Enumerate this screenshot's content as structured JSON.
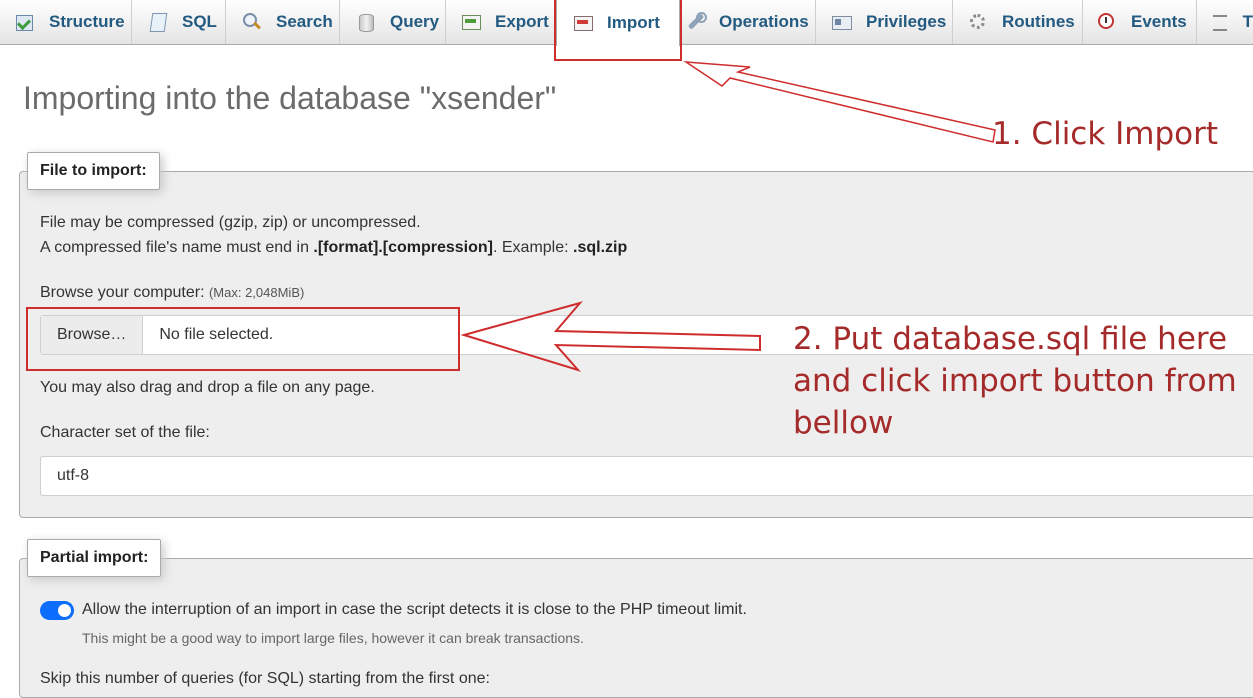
{
  "tabs": [
    {
      "label": "Structure",
      "icon": "structure-icon"
    },
    {
      "label": "SQL",
      "icon": "sql-icon"
    },
    {
      "label": "Search",
      "icon": "search-icon"
    },
    {
      "label": "Query",
      "icon": "query-icon"
    },
    {
      "label": "Export",
      "icon": "export-icon"
    },
    {
      "label": "Import",
      "icon": "import-icon",
      "active": true
    },
    {
      "label": "Operations",
      "icon": "operations-icon"
    },
    {
      "label": "Privileges",
      "icon": "privileges-icon"
    },
    {
      "label": "Routines",
      "icon": "routines-icon"
    },
    {
      "label": "Events",
      "icon": "events-icon"
    },
    {
      "label": "T",
      "icon": "triggers-icon"
    }
  ],
  "page": {
    "title": "Importing into the database \"xsender\""
  },
  "file_import": {
    "legend": "File to import:",
    "line1": "File may be compressed (gzip, zip) or uncompressed.",
    "line2_prefix": "A compressed file's name must end in ",
    "line2_format": ".[format].[compression]",
    "line2_mid": ". Example: ",
    "line2_example": ".sql.zip",
    "browse_label": "Browse your computer: ",
    "max_size": "(Max: 2,048MiB)",
    "browse_button": "Browse…",
    "file_status": "No file selected.",
    "drag_hint": "You may also drag and drop a file on any page.",
    "charset_label": "Character set of the file:",
    "charset_value": "utf-8"
  },
  "partial_import": {
    "legend": "Partial import:",
    "toggle_on": true,
    "allow_interrupt": "Allow the interruption of an import in case the script detects it is close to the PHP timeout limit.",
    "allow_interrupt_hint": "This might be a good way to import large files, however it can break transactions.",
    "skip_text": "Skip this number of queries (for SQL) starting from the first one:"
  },
  "annotations": {
    "step1": "1. Click Import",
    "step2_line1": "2. Put database.sql file here",
    "step2_line2": "and click import button from",
    "step2_line3": "bellow"
  },
  "colors": {
    "tab_text": "#235a81",
    "annotation_red": "#cf2d2d",
    "annotation_text": "#a52a2a",
    "toggle_on": "#0d6efd"
  }
}
